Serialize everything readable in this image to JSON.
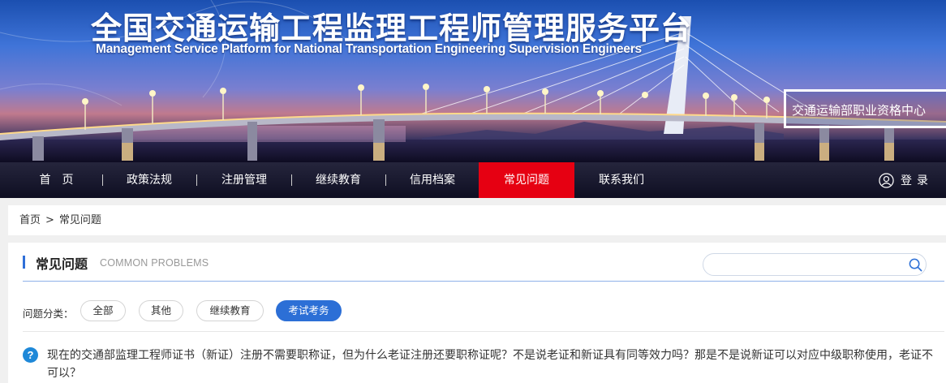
{
  "header": {
    "title_cn": "全国交通运输工程监理工程师管理服务平台",
    "title_en": "Management Service Platform for National Transportation Engineering Supervision Engineers",
    "center_label": "交通运输部职业资格中心"
  },
  "nav": {
    "items": [
      {
        "label": "首　页"
      },
      {
        "label": "政策法规"
      },
      {
        "label": "注册管理"
      },
      {
        "label": "继续教育"
      },
      {
        "label": "信用档案"
      },
      {
        "label": "常见问题",
        "active": true
      },
      {
        "label": "联系我们"
      }
    ],
    "login_label": "登录",
    "active_color": "#e60012"
  },
  "breadcrumb": {
    "home": "首页",
    "separator": ">",
    "current": "常见问题"
  },
  "section": {
    "title": "常见问题",
    "subtitle": "COMMON PROBLEMS",
    "accent_color": "#2f6fd8"
  },
  "search": {
    "placeholder": "",
    "value": "",
    "icon": "search-icon"
  },
  "categories": {
    "label": "问题分类：",
    "items": [
      {
        "label": "全部"
      },
      {
        "label": "其他"
      },
      {
        "label": "继续教育"
      },
      {
        "label": "考试考务",
        "active": true
      }
    ],
    "active_color": "#2c6fd6"
  },
  "questions": [
    {
      "icon": "question-icon",
      "text": "现在的交通部监理工程师证书（新证）注册不需要职称证，但为什么老证注册还要职称证呢？不是说老证和新证具有同等效力吗？那是不是说新证可以对应中级职称使用，老证不可以？"
    }
  ]
}
